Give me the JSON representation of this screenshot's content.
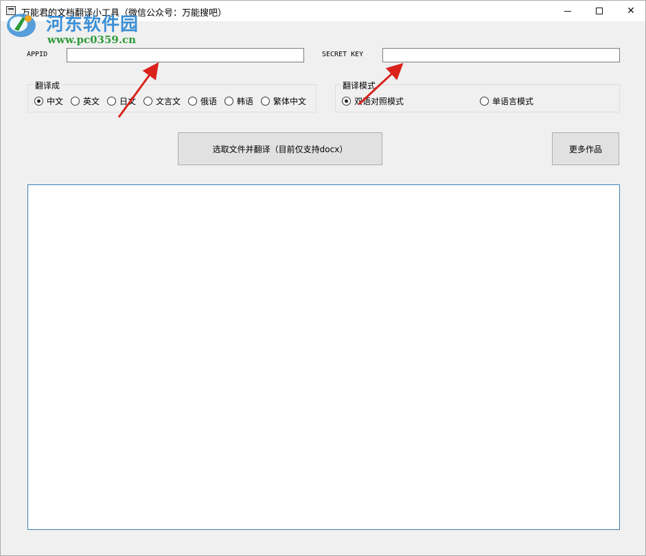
{
  "window": {
    "title": "万能君的文档翻译小工具（微信公众号：万能搜吧）",
    "controls": {
      "minimize": "—",
      "maximize": "☐",
      "close": "✕"
    }
  },
  "watermark": {
    "name": "河东软件园",
    "url": "www.pc0359.cn"
  },
  "credentials": {
    "appid_label": "APPID",
    "appid_value": "",
    "secret_label": "SECRET KEY",
    "secret_value": ""
  },
  "translate_to": {
    "title": "翻译成",
    "options": [
      "中文",
      "英文",
      "日文",
      "文言文",
      "俄语",
      "韩语",
      "繁体中文"
    ],
    "selected": "中文"
  },
  "translate_mode": {
    "title": "翻译模式",
    "options": [
      "双语对照模式",
      "单语言模式"
    ],
    "selected": "双语对照模式"
  },
  "buttons": {
    "select_file": "选取文件并翻译（目前仅支持docx）",
    "more_works": "更多作品"
  },
  "output": {
    "text": ""
  },
  "colors": {
    "arrow": "#d9221c",
    "output_border": "#3c7fb1",
    "button_bg": "#e1e1e1"
  }
}
